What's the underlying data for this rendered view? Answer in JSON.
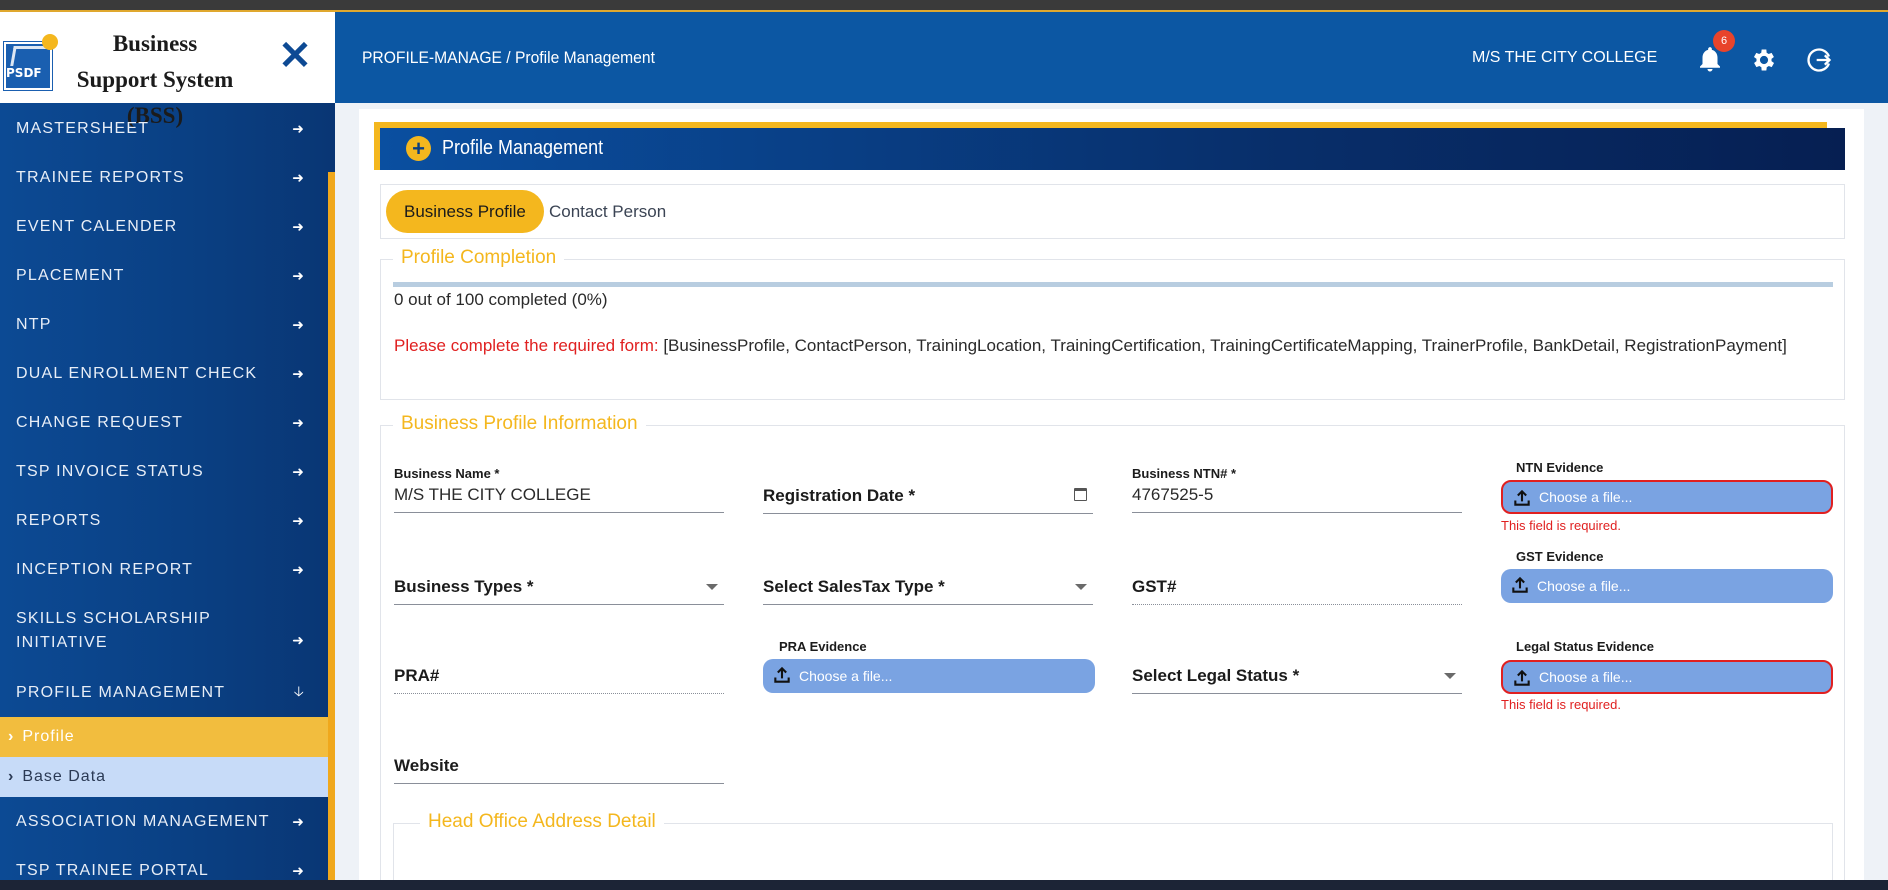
{
  "brand": {
    "title": "Business Support System (BSS)",
    "logo_text": "PSDF",
    "close_glyph": "✕"
  },
  "sidebar": {
    "items": [
      {
        "label": "MASTERSHEET"
      },
      {
        "label": "TRAINEE REPORTS"
      },
      {
        "label": "EVENT CALENDER"
      },
      {
        "label": "PLACEMENT"
      },
      {
        "label": "NTP"
      },
      {
        "label": "DUAL ENROLLMENT CHECK"
      },
      {
        "label": "CHANGE REQUEST"
      },
      {
        "label": "TSP INVOICE STATUS"
      },
      {
        "label": "REPORTS"
      },
      {
        "label": "INCEPTION REPORT"
      },
      {
        "label": "SKILLS SCHOLARSHIP INITIATIVE"
      },
      {
        "label": "PROFILE MANAGEMENT"
      }
    ],
    "sub_items": [
      {
        "label": "Profile",
        "active": true
      },
      {
        "label": "Base Data",
        "active": false
      }
    ],
    "after_items": [
      {
        "label": "ASSOCIATION MANAGEMENT"
      },
      {
        "label": "TSP TRAINEE PORTAL"
      }
    ]
  },
  "header": {
    "breadcrumb": "PROFILE-MANAGE / Profile Management",
    "college": "M/S THE CITY COLLEGE",
    "notification_count": "6"
  },
  "panel": {
    "title": "Profile Management"
  },
  "tabs": [
    {
      "label": "Business Profile",
      "active": true
    },
    {
      "label": "Contact Person",
      "active": false
    }
  ],
  "completion": {
    "legend": "Profile Completion",
    "progress": 0,
    "text": "0 out of 100 completed (0%)",
    "msg_prefix": "Please complete the required form:",
    "msg_list": " [BusinessProfile, ContactPerson, TrainingLocation, TrainingCertification, TrainingCertificateMapping, TrainerProfile, BankDetail, RegistrationPayment]"
  },
  "business_profile": {
    "legend": "Business Profile Information",
    "business_name_label": "Business Name *",
    "business_name_value": "M/S THE CITY COLLEGE",
    "registration_date_label": "Registration Date *",
    "ntn_label": "Business NTN# *",
    "ntn_value": "4767525-5",
    "ntn_evidence_label": "NTN Evidence",
    "business_types_label": "Business Types *",
    "salestax_label": "Select SalesTax Type *",
    "gst_label": "GST#",
    "gst_evidence_label": "GST Evidence",
    "pra_label": "PRA#",
    "pra_evidence_label": "PRA Evidence",
    "legal_status_label": "Select Legal Status *",
    "legal_evidence_label": "Legal Status Evidence",
    "website_label": "Website",
    "choose_file": "Choose a file...",
    "required_error": "This field is required."
  },
  "head_office": {
    "legend": "Head Office Address Detail"
  },
  "colors": {
    "primary": "#0c57a3",
    "accent": "#f4b71e",
    "error": "#e02020",
    "file_button": "#7aa3e2"
  }
}
